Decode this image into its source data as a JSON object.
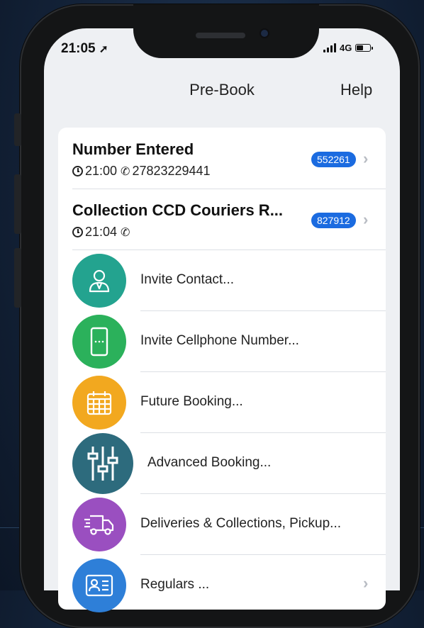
{
  "status_bar": {
    "time": "21:05",
    "network": "4G"
  },
  "nav": {
    "title": "Pre-Book",
    "help": "Help"
  },
  "bookings": [
    {
      "title": "Number Entered",
      "time": "21:00",
      "phone": "27823229441",
      "badge": "552261"
    },
    {
      "title": "Collection CCD Couriers  R...",
      "time": "21:04",
      "phone": "",
      "badge": "827912"
    }
  ],
  "menu": [
    {
      "label": "Invite Contact...",
      "icon": "person-icon",
      "color": "#23a38f"
    },
    {
      "label": "Invite Cellphone Number...",
      "icon": "cellphone-icon",
      "color": "#2bb15b"
    },
    {
      "label": "Future Booking...",
      "icon": "calendar-icon",
      "color": "#f2a81f"
    },
    {
      "label": "Advanced Booking...",
      "icon": "sliders-icon",
      "color": "#2d6b7d"
    },
    {
      "label": "Deliveries & Collections, Pickup...",
      "icon": "delivery-truck-icon",
      "color": "#9a4fc0"
    },
    {
      "label": "Regulars ...",
      "icon": "id-card-icon",
      "color": "#2e7fd8"
    }
  ],
  "colors": {
    "badge": "#1b6be0",
    "accent": "#111111"
  }
}
